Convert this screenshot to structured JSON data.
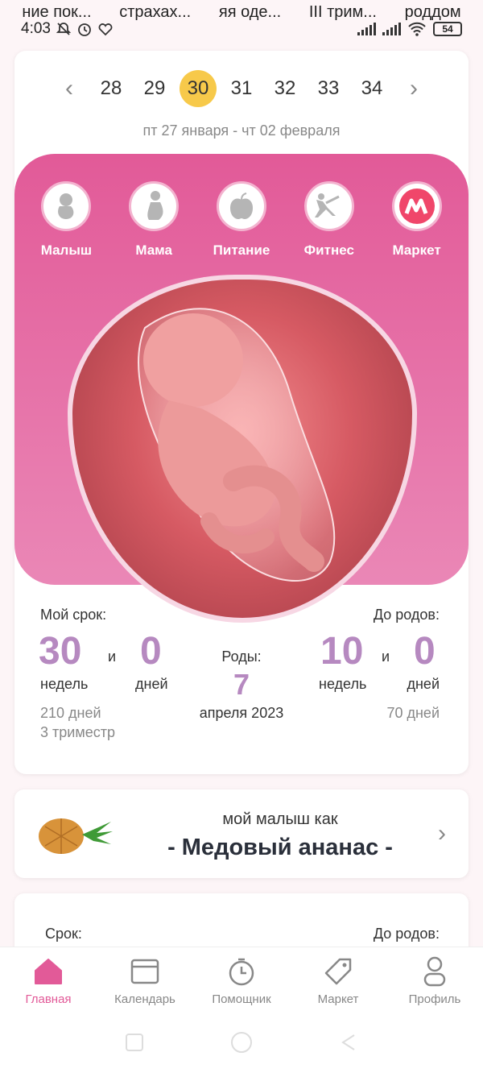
{
  "notifications": [
    "ние пок...",
    "страхах...",
    "яя оде...",
    "III трим...",
    "роддом"
  ],
  "status": {
    "time": "4:03",
    "battery": "54"
  },
  "week_nav": {
    "weeks": [
      "28",
      "29",
      "30",
      "31",
      "32",
      "33",
      "34"
    ],
    "active_week": "30",
    "prev": "‹",
    "next": "›"
  },
  "date_range": "пт 27 января - чт 02 февраля",
  "categories": [
    {
      "label": "Малыш",
      "icon": "baby-icon"
    },
    {
      "label": "Мама",
      "icon": "mother-icon"
    },
    {
      "label": "Питание",
      "icon": "apple-icon"
    },
    {
      "label": "Фитнес",
      "icon": "fitness-icon"
    },
    {
      "label": "Маркет",
      "icon": "market-logo-icon"
    }
  ],
  "stats": {
    "my_term_label": "Мой срок:",
    "weeks_value": "30",
    "and1": "и",
    "days_value": "0",
    "weeks_unit": "недель",
    "days_unit": "дней",
    "total_days": "210 дней",
    "trimester": "3 триместр",
    "birth_label": "Роды:",
    "birth_day": "7",
    "birth_month_year": "апреля 2023",
    "to_birth_label": "До родов:",
    "remain_weeks": "10",
    "and2": "и",
    "remain_days": "0",
    "remain_weeks_unit": "недель",
    "remain_days_unit": "дней",
    "remain_total_days": "70 дней"
  },
  "baby_card": {
    "subtitle": "мой малыш как",
    "title": "- Медовый ананас -"
  },
  "card3": {
    "left_label": "Срок:",
    "right_label": "До родов:"
  },
  "bottom_nav": [
    {
      "label": "Главная",
      "icon": "home-icon",
      "active": true
    },
    {
      "label": "Календарь",
      "icon": "calendar-icon",
      "active": false
    },
    {
      "label": "Помощник",
      "icon": "timer-icon",
      "active": false
    },
    {
      "label": "Маркет",
      "icon": "tag-icon",
      "active": false
    },
    {
      "label": "Профиль",
      "icon": "profile-icon",
      "active": false
    }
  ],
  "colors": {
    "accent_pink": "#e25a98",
    "accent_purple": "#b689c0",
    "active_week": "#f7c94a"
  }
}
